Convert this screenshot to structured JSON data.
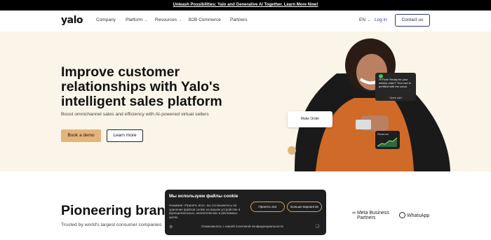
{
  "announcement": "Unleash Possibilities: Yalo and Generative AI Together. Learn More Now!",
  "nav": {
    "logo": "yalo",
    "items": [
      {
        "label": "Company",
        "dropdown": false
      },
      {
        "label": "Platform",
        "dropdown": true
      },
      {
        "label": "Resources",
        "dropdown": true
      },
      {
        "label": "B2B Commerce",
        "dropdown": false
      },
      {
        "label": "Partners",
        "dropdown": false
      }
    ],
    "language": "EN",
    "login": "Log in",
    "contact": "Contact us"
  },
  "hero": {
    "title": "Improve customer relationships with Yalo's intelligent sales platform",
    "subtitle": "Boost omnichannel sales and efficiency with AI-powered virtual sellers",
    "demo_button": "Book a demo",
    "learn_button": "Learn more",
    "message_card": {
      "text": "Hi Pam! Ready for your weekly order? Your cart is prefilled with the usual.",
      "action": "Open cart"
    },
    "order_card": "Make Order",
    "revenue_card": "Revenue"
  },
  "section": {
    "title": "Pioneering brand",
    "subtitle": "Trusted by world's largest consumer companies",
    "partners": [
      "Meta Business Partners",
      "WhatsApp"
    ]
  },
  "cookie": {
    "title": "Мы используем файлы cookie",
    "text": "Нажимая «Принять все», вы соглашаетесь на хранение файлов cookie на вашем устройстве в функциональных, аналитических и рекламных целях.",
    "accept": "Принять все",
    "more": "Больше вариантов",
    "policy": "Ознакомьтесь с нашей политикой конфиденциальности"
  },
  "colors": {
    "hero_bg": "#faf5e8",
    "demo_button": "#e5b47b",
    "login_link": "#2a3ad6"
  }
}
